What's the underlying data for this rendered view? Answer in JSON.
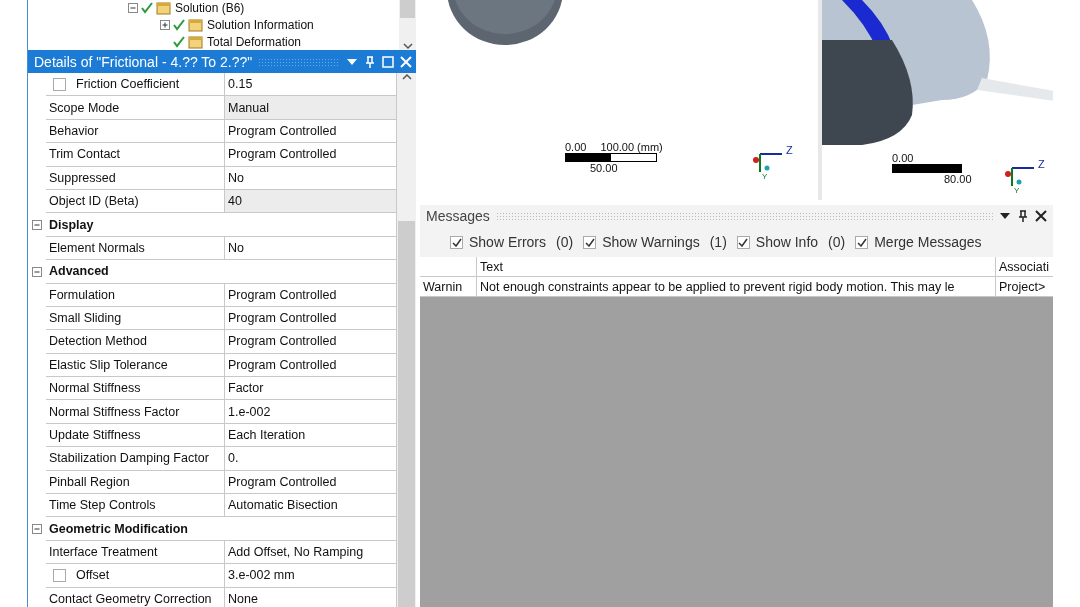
{
  "tree": {
    "items": [
      {
        "label": "Solution (B6)",
        "expanded": true,
        "children": [
          {
            "label": "Solution Information",
            "expanded": false
          },
          {
            "label": "Total Deformation"
          }
        ]
      }
    ]
  },
  "details": {
    "title": "Details of \"Frictional - 4.?? To 2.??\"",
    "rows": [
      {
        "kind": "property",
        "name": "Friction Coefficient",
        "value": "0.15",
        "checked": false
      },
      {
        "kind": "property",
        "name": "Scope Mode",
        "value": "Manual",
        "readonly": true
      },
      {
        "kind": "property",
        "name": "Behavior",
        "value": "Program Controlled"
      },
      {
        "kind": "property",
        "name": "Trim Contact",
        "value": "Program Controlled"
      },
      {
        "kind": "property",
        "name": "Suppressed",
        "value": "No"
      },
      {
        "kind": "property",
        "name": "Object ID (Beta)",
        "value": "40",
        "readonly": true
      },
      {
        "kind": "section",
        "name": "Display",
        "expanded": true
      },
      {
        "kind": "property",
        "name": "Element Normals",
        "value": "No"
      },
      {
        "kind": "section",
        "name": "Advanced",
        "expanded": true
      },
      {
        "kind": "property",
        "name": "Formulation",
        "value": "Program Controlled"
      },
      {
        "kind": "property",
        "name": "Small Sliding",
        "value": "Program Controlled"
      },
      {
        "kind": "property",
        "name": "Detection Method",
        "value": "Program Controlled"
      },
      {
        "kind": "property",
        "name": "Elastic Slip Tolerance",
        "value": "Program Controlled"
      },
      {
        "kind": "property",
        "name": "Normal Stiffness",
        "value": "Factor"
      },
      {
        "kind": "property",
        "name": "Normal Stiffness Factor",
        "value": "1.e-002"
      },
      {
        "kind": "property",
        "name": "Update Stiffness",
        "value": "Each Iteration"
      },
      {
        "kind": "property",
        "name": "Stabilization Damping Factor",
        "value": "0."
      },
      {
        "kind": "property",
        "name": "Pinball Region",
        "value": "Program Controlled"
      },
      {
        "kind": "property",
        "name": "Time Step Controls",
        "value": "Automatic Bisection"
      },
      {
        "kind": "section",
        "name": "Geometric Modification",
        "expanded": true
      },
      {
        "kind": "property",
        "name": "Interface Treatment",
        "value": "Add Offset, No Ramping"
      },
      {
        "kind": "property",
        "name": "Offset",
        "value": "3.e-002 mm",
        "checked": false
      },
      {
        "kind": "property",
        "name": "Contact Geometry Correction",
        "value": "None"
      }
    ]
  },
  "viewports": [
    {
      "scale_start": "0.00",
      "scale_end": "100.00 (mm)",
      "scale_mid": "50.00",
      "axis_labels": [
        "Z",
        "Y"
      ]
    },
    {
      "scale_start": "0.00",
      "scale_end": "80.00",
      "axis_labels": [
        "Z",
        "Y"
      ]
    }
  ],
  "messages": {
    "title": "Messages",
    "filters": [
      {
        "label": "Show Errors",
        "count": "(0)",
        "checked": true
      },
      {
        "label": "Show Warnings",
        "count": "(1)",
        "checked": true
      },
      {
        "label": "Show Info",
        "count": "(0)",
        "checked": true
      },
      {
        "label": "Merge Messages",
        "checked": true
      }
    ],
    "columns": [
      "",
      "Text",
      "Associati"
    ],
    "rows": [
      {
        "cells": [
          "Warnin",
          "Not enough constraints appear to be applied to prevent rigid body motion.  This may le",
          "Project>"
        ]
      }
    ]
  }
}
